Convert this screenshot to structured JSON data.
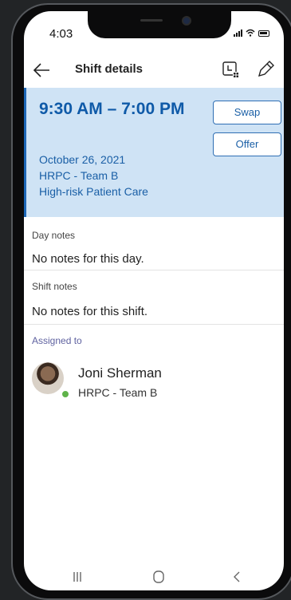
{
  "status_bar": {
    "time": "4:03"
  },
  "header": {
    "title": "Shift details"
  },
  "shift": {
    "time_range": "9:30 AM – 7:00 PM",
    "date": "October 26, 2021",
    "team": "HRPC - Team B",
    "group": "High-risk Patient Care",
    "swap_label": "Swap",
    "offer_label": "Offer",
    "color": "#cfe3f5",
    "accent": "#1c66b6"
  },
  "day_notes": {
    "label": "Day notes",
    "text": "No notes for this day."
  },
  "shift_notes": {
    "label": "Shift notes",
    "text": "No notes for this shift."
  },
  "assigned": {
    "label": "Assigned to",
    "name": "Joni Sherman",
    "team": "HRPC - Team B",
    "presence": "available"
  }
}
